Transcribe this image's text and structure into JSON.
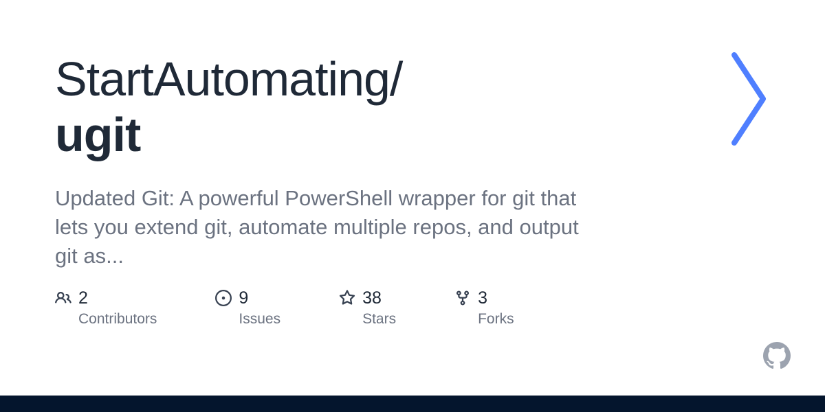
{
  "repo": {
    "owner": "StartAutomating/",
    "name": "ugit"
  },
  "description": "Updated Git: A powerful PowerShell wrapper for git that lets you extend git, automate multiple repos, and output git as...",
  "stats": {
    "contributors": {
      "value": "2",
      "label": "Contributors"
    },
    "issues": {
      "value": "9",
      "label": "Issues"
    },
    "stars": {
      "value": "38",
      "label": "Stars"
    },
    "forks": {
      "value": "3",
      "label": "Forks"
    }
  }
}
